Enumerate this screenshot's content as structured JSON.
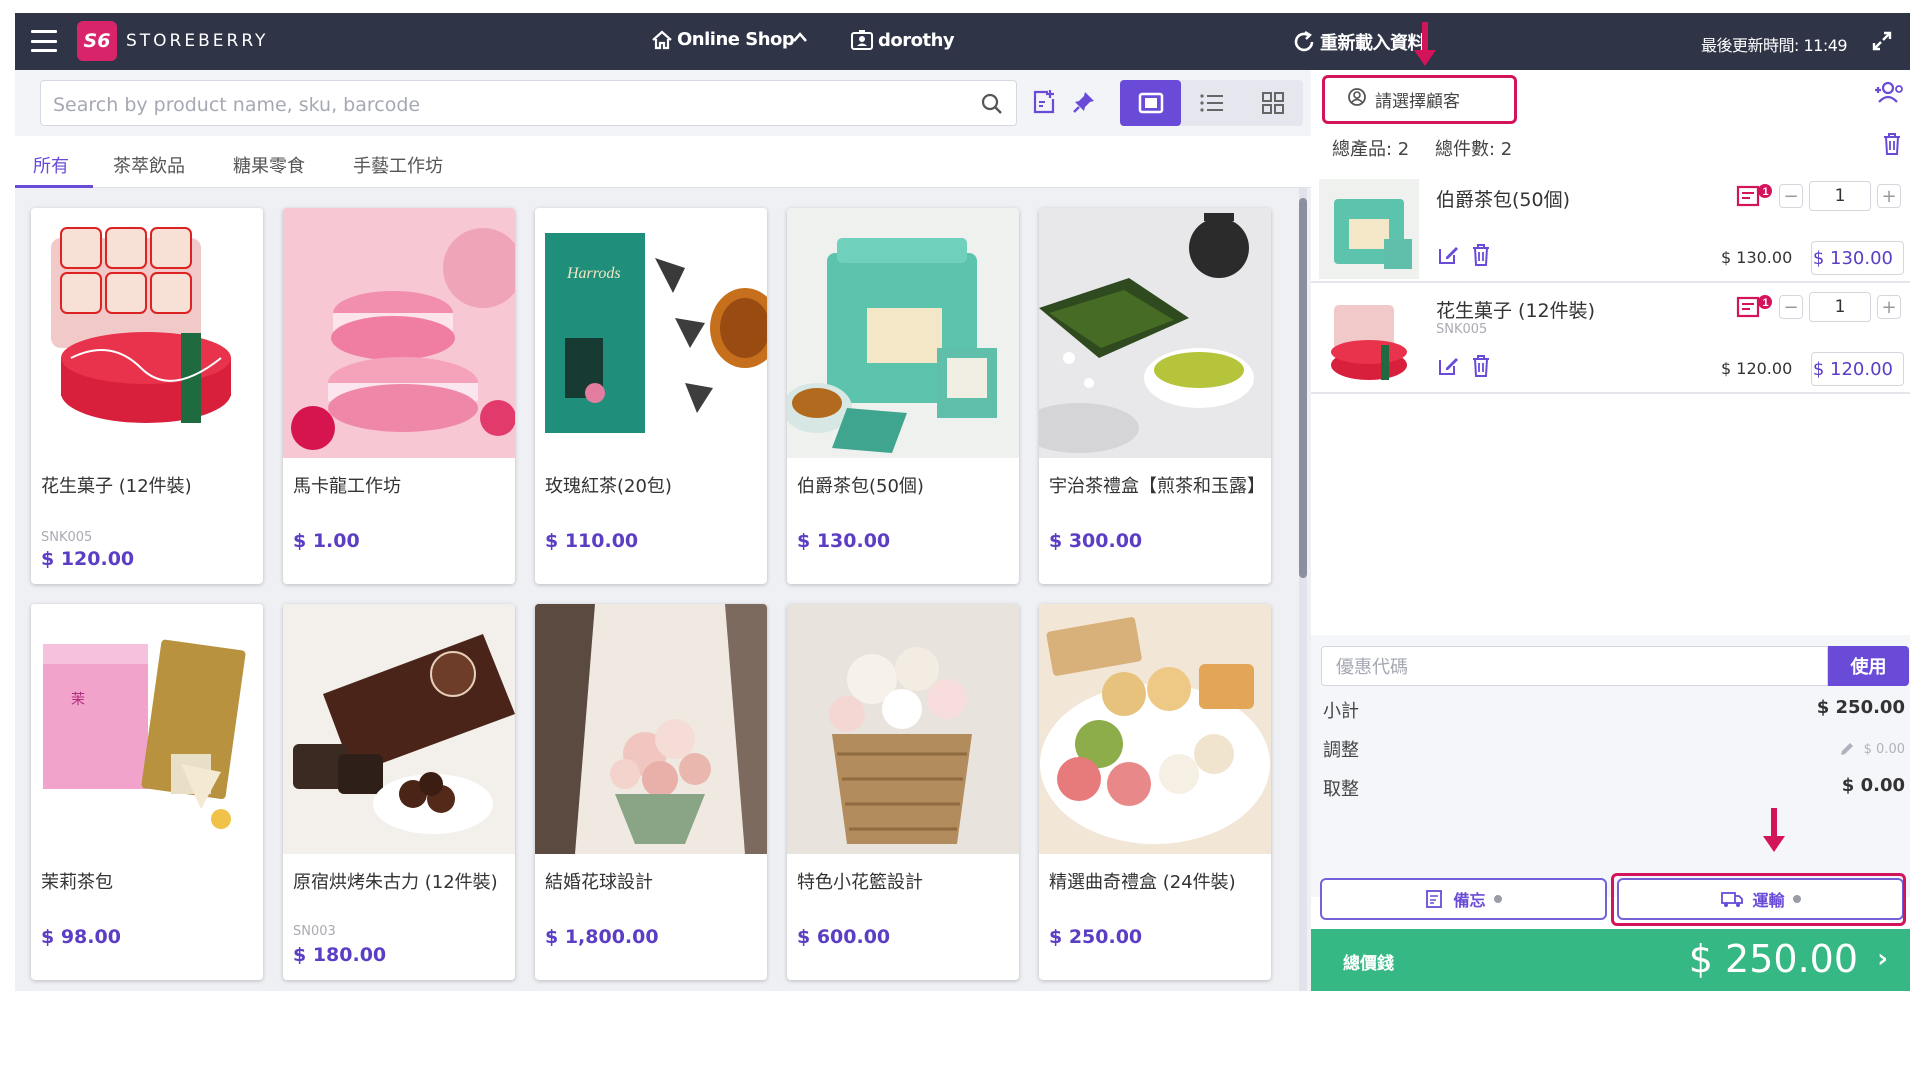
{
  "topbar": {
    "brand": "STOREBERRY",
    "logo_text": "S6",
    "shop": "Online Shop",
    "user": "dorothy",
    "reload": "重新載入資料",
    "last_update": "最後更新時間: 11:49"
  },
  "search": {
    "placeholder": "Search by product name, sku, barcode"
  },
  "tabs": [
    "所有",
    "茶萃飲品",
    "糖果零食",
    "手藝工作坊"
  ],
  "products": [
    {
      "name": "花生菓子 (12件裝)",
      "sku": "SNK005",
      "price": "$ 120.00"
    },
    {
      "name": "馬卡龍工作坊",
      "sku": "",
      "price": "$ 1.00"
    },
    {
      "name": "玫瑰紅茶(20包)",
      "sku": "",
      "price": "$ 110.00"
    },
    {
      "name": "伯爵茶包(50個)",
      "sku": "",
      "price": "$ 130.00"
    },
    {
      "name": "宇治茶禮盒【煎茶和玉露】",
      "sku": "",
      "price": "$ 300.00"
    },
    {
      "name": "茉莉茶包",
      "sku": "",
      "price": "$ 98.00"
    },
    {
      "name": "原宿烘烤朱古力 (12件裝)",
      "sku": "SN003",
      "price": "$ 180.00"
    },
    {
      "name": "結婚花球設計",
      "sku": "",
      "price": "$ 1,800.00"
    },
    {
      "name": "特色小花籃設計",
      "sku": "",
      "price": "$ 600.00"
    },
    {
      "name": "精選曲奇禮盒 (24件裝)",
      "sku": "",
      "price": "$ 250.00"
    }
  ],
  "cart": {
    "customer_label": "請選擇顧客",
    "total_products": "總產品: 2",
    "total_items": "總件數: 2",
    "items": [
      {
        "name": "伯爵茶包(50個)",
        "sku": "",
        "qty": "1",
        "badge": "1",
        "unit_price": "$ 130.00",
        "line_total": "$  130.00"
      },
      {
        "name": "花生菓子 (12件裝)",
        "sku": "SNK005",
        "qty": "1",
        "badge": "1",
        "unit_price": "$ 120.00",
        "line_total": "$  120.00"
      }
    ]
  },
  "summary": {
    "coupon_placeholder": "優惠代碼",
    "coupon_button": "使用",
    "subtotal_label": "小計",
    "subtotal": "$ 250.00",
    "adjust_label": "調整",
    "adjust": "$ 0.00",
    "rounding_label": "取整",
    "rounding": "$ 0.00",
    "memo_button": "備忘",
    "shipping_button": "運輸",
    "total_label": "總價錢",
    "total": "$ 250.00"
  },
  "colors": {
    "accent": "#6a4bd8",
    "topbar": "#2f3447",
    "checkout": "#35b883",
    "highlight": "#d4145a"
  }
}
